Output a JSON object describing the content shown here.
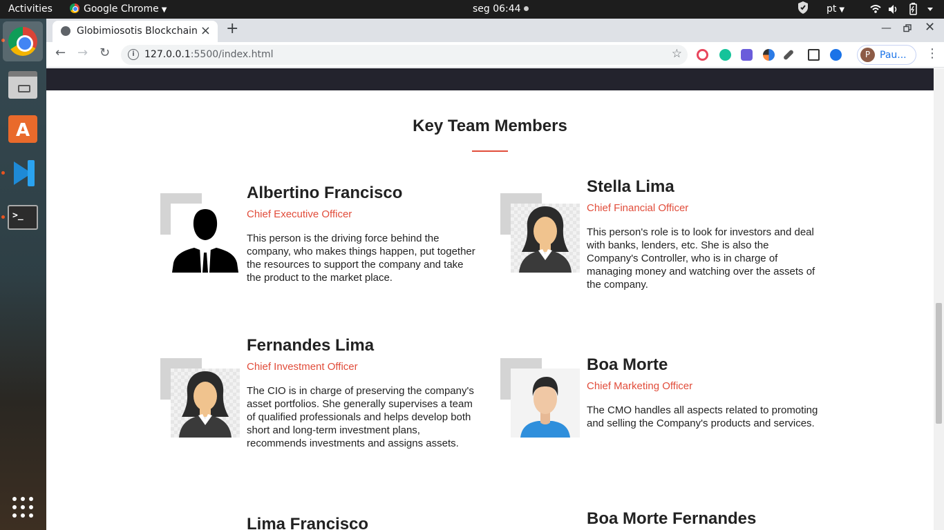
{
  "system_bar": {
    "activities": "Activities",
    "app_name": "Google Chrome",
    "clock": "seg 06:44",
    "language": "pt"
  },
  "browser": {
    "tab_title": "Globimiosotis Blockchain",
    "url_host": "127.0.0.1",
    "url_rest": ":5500/index.html",
    "profile_initial": "P",
    "profile_name": "Pau..."
  },
  "section": {
    "title": "Key Team Members",
    "accent_color": "#e14c3a"
  },
  "members": [
    {
      "name": "Albertino Francisco",
      "role": "Chief Executive Officer",
      "description": "This person is the driving force behind the company, who makes things happen, put together the resources to support the company and take the product to the market place.",
      "avatar": "male-silhouette-suit"
    },
    {
      "name": "Stella Lima",
      "role": "Chief Financial Officer",
      "description": "This person's role is to look for investors and deal with banks, lenders, etc. She is also the Company's Controller, who is in charge of managing money and watching over the assets of the company.",
      "avatar": "female-business"
    },
    {
      "name": "Fernandes Lima",
      "role": "Chief Investment Officer",
      "description": "The CIO is in charge of preserving the company's asset portfolios. She generally supervises a team of qualified professionals and helps develop both short and long-term investment plans, recommends investments and assigns assets.",
      "avatar": "female-business"
    },
    {
      "name": "Boa Morte",
      "role": "Chief Marketing Officer",
      "description": "The CMO handles all aspects related to promoting and selling the Company's products and services.",
      "avatar": "male-blue-shirt"
    },
    {
      "name": "Lima Francisco",
      "avatar": "unknown"
    },
    {
      "name": "Boa Morte Fernandes",
      "avatar": "unknown"
    }
  ]
}
